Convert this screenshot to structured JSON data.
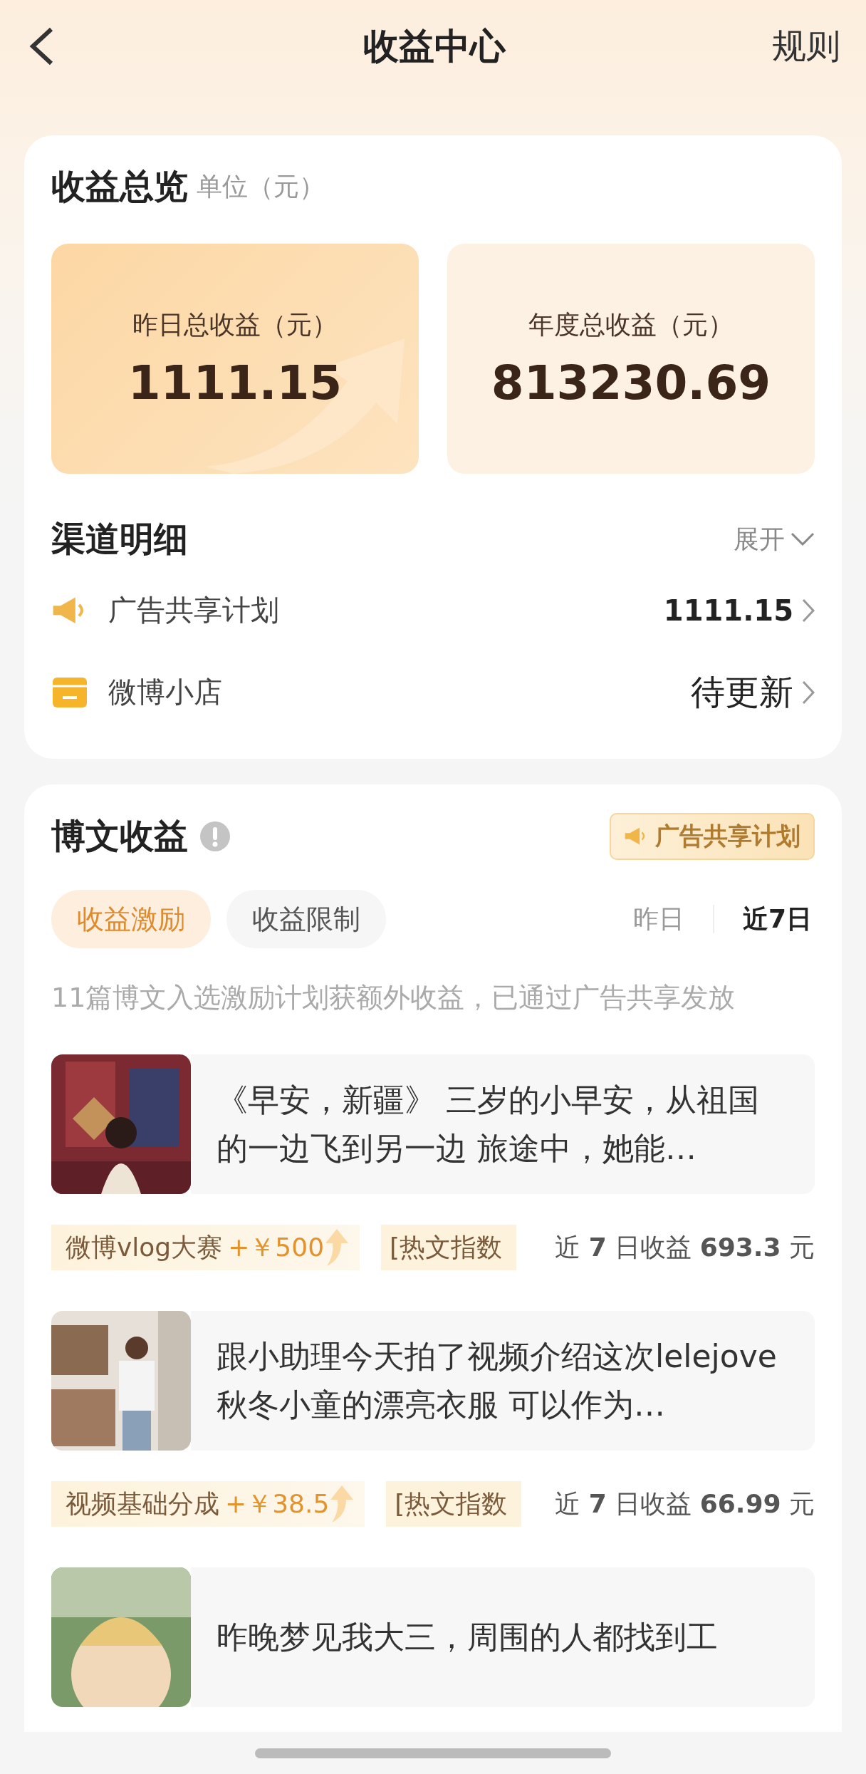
{
  "header": {
    "title": "收益中心",
    "action": "规则"
  },
  "overview": {
    "title": "收益总览",
    "unit": "单位（元）",
    "stats": [
      {
        "label": "昨日总收益（元）",
        "value": "1111.15",
        "highlight": true
      },
      {
        "label": "年度总收益（元）",
        "value": "813230.69",
        "highlight": false
      }
    ]
  },
  "channels": {
    "title": "渠道明细",
    "toggle": "展开",
    "expanded": false,
    "items": [
      {
        "kind": "megaphone",
        "name": "广告共享计划",
        "value": "1111.15"
      },
      {
        "kind": "shop",
        "name": "微博小店",
        "value": "待更新"
      }
    ]
  },
  "posts": {
    "title": "博文收益",
    "badge": "广告共享计划",
    "tabs": [
      {
        "label": "收益激励",
        "selected": true
      },
      {
        "label": "收益限制",
        "selected": false
      }
    ],
    "periods": [
      {
        "label": "昨日",
        "selected": false
      },
      {
        "label": "近7日",
        "selected": true
      }
    ],
    "note": "11篇博文入选激励计划获额外收益，已通过广告共享发放",
    "items": [
      {
        "text": "《早安，新疆》 三岁的小早安，从祖国的一边飞到另一边 旅途中，她能…",
        "tags": [
          {
            "label": "微博vlog大赛",
            "bonus": "+￥500"
          },
          {
            "label": "[热文指数"
          }
        ],
        "earning": "近 **7** 日收益 **693.3** 元"
      },
      {
        "text": "跟小助理今天拍了视频介绍这次lelejove 秋冬小童的漂亮衣服 可以作为…",
        "tags": [
          {
            "label": "视频基础分成",
            "bonus": "+￥38.5"
          },
          {
            "label": "[热文指数"
          }
        ],
        "earning": "近 **7** 日收益 **66.99** 元"
      },
      {
        "text": "昨晚梦见我大三，周围的人都找到工"
      }
    ]
  }
}
